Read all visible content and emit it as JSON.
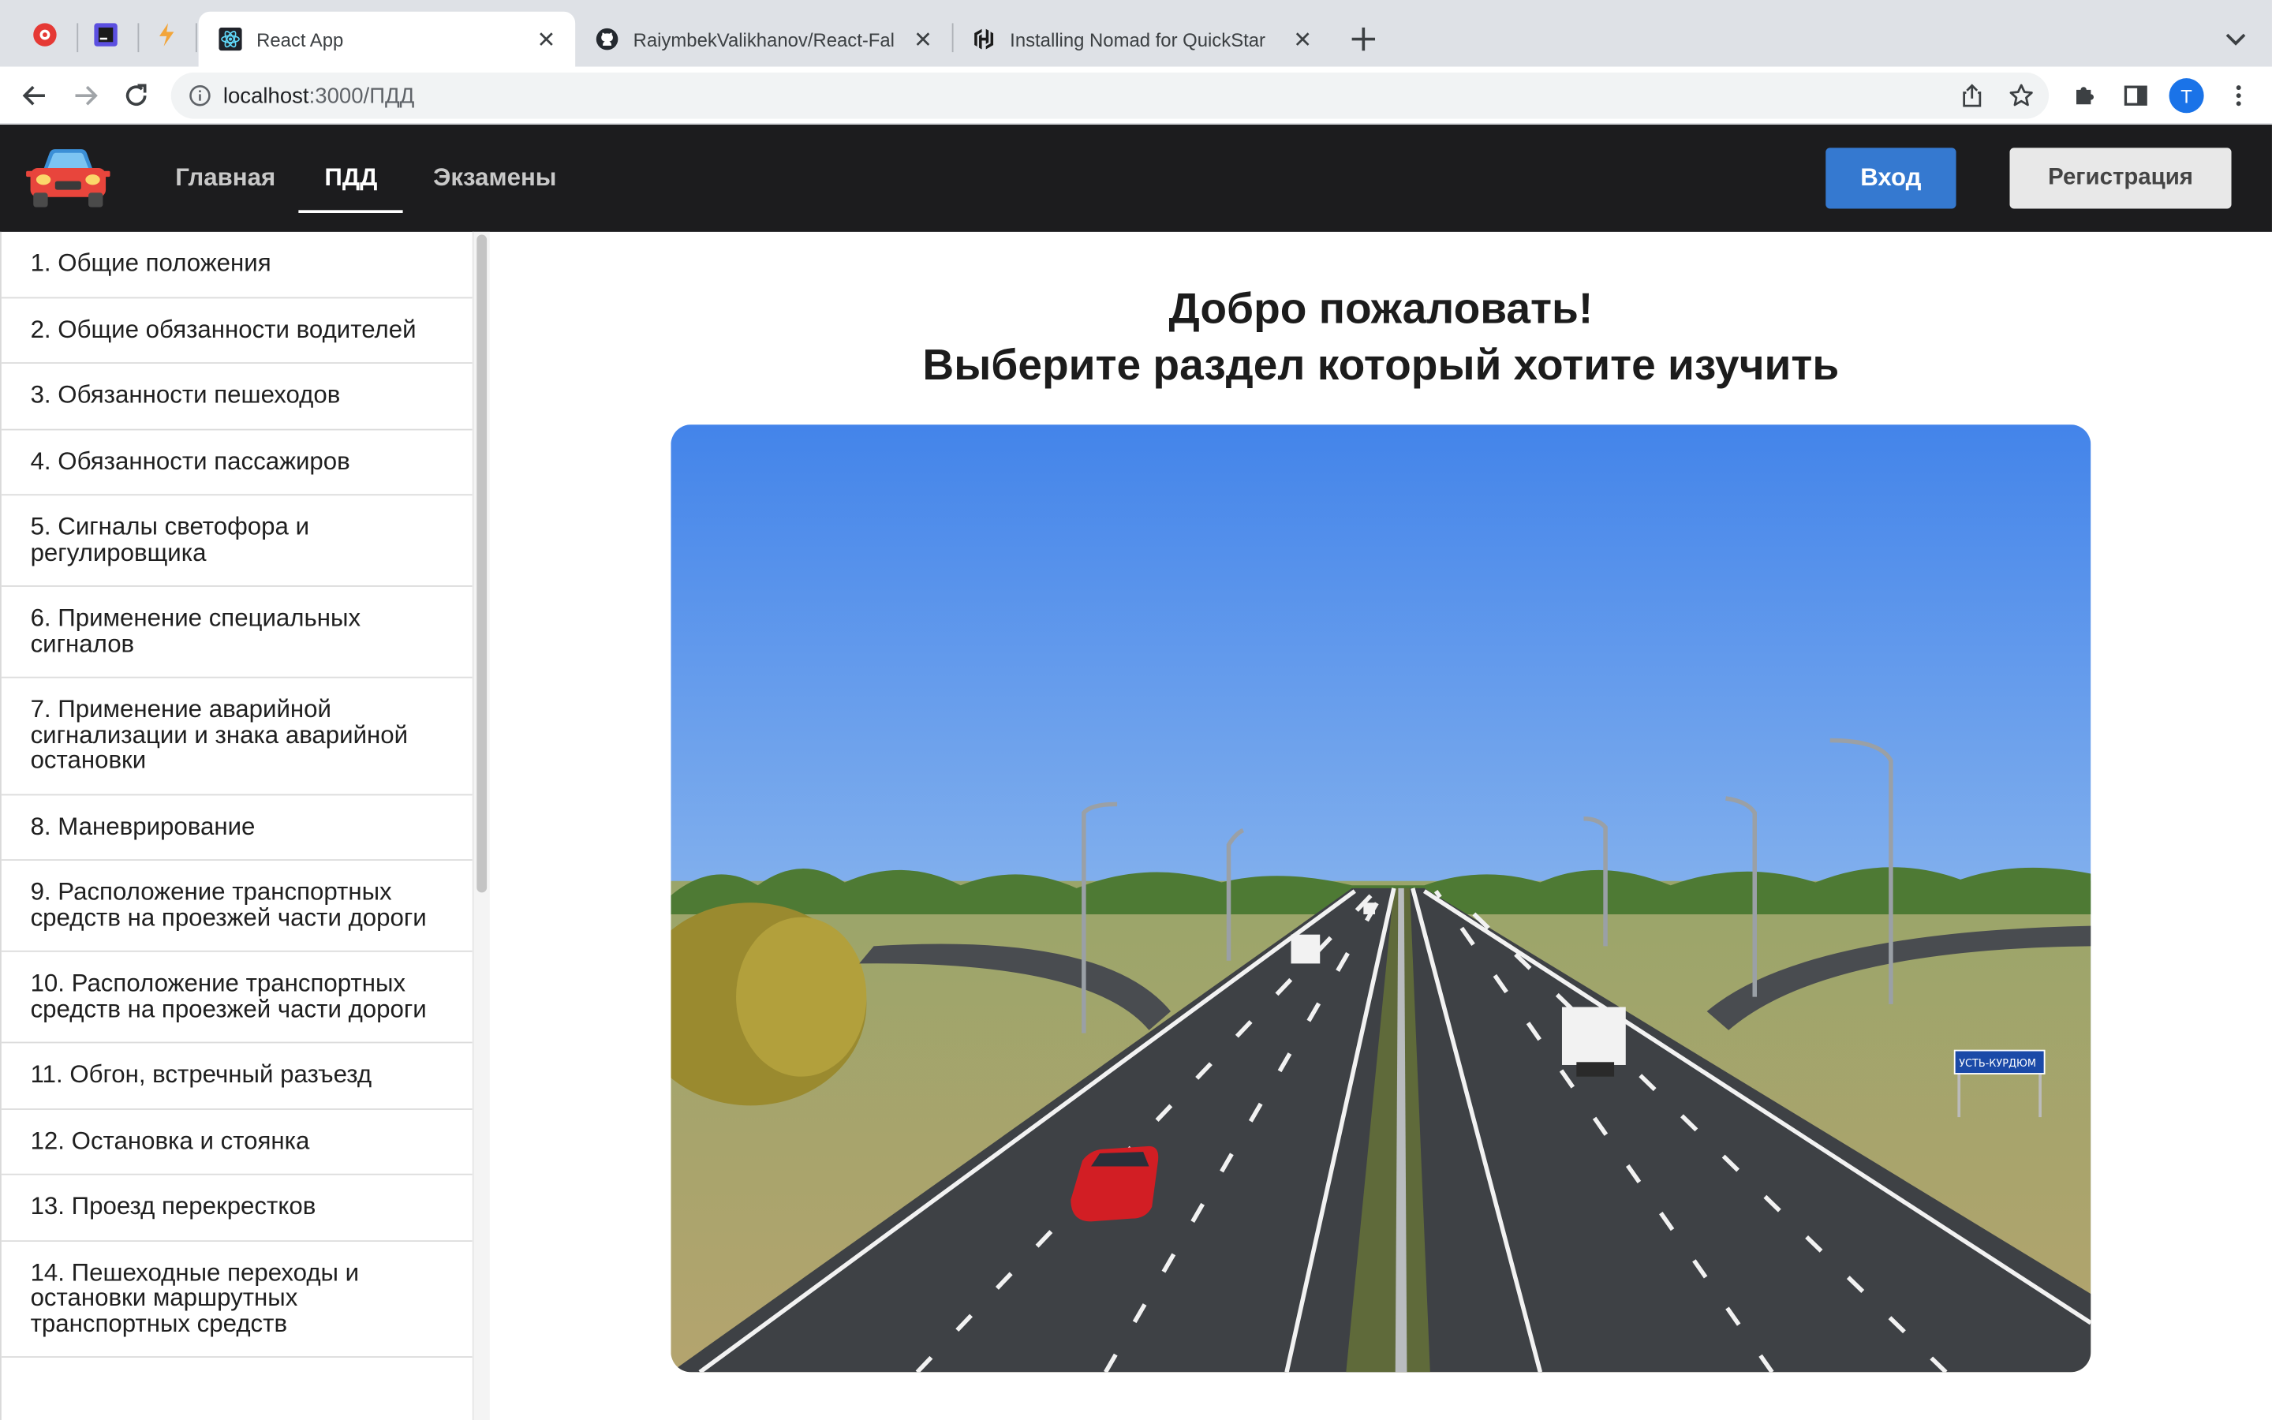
{
  "browser": {
    "pinned_tabs": [
      {
        "icon": "opera-red-icon"
      },
      {
        "icon": "intellij-icon"
      },
      {
        "icon": "chrome-labs-icon"
      }
    ],
    "tabs": [
      {
        "title": "React App",
        "icon": "react-logo-icon",
        "active": true
      },
      {
        "title": "RaiymbekValikhanov/React-Fal",
        "icon": "github-icon",
        "active": false
      },
      {
        "title": "Installing Nomad for QuickStar",
        "icon": "hashicorp-icon",
        "active": false
      }
    ],
    "url_host": "localhost",
    "url_rest": ":3000/ПДД",
    "profile_initial": "T"
  },
  "header": {
    "nav": [
      "Главная",
      "ПДД",
      "Экзамены"
    ],
    "active_nav": "ПДД",
    "login_label": "Вход",
    "register_label": "Регистрация"
  },
  "sidebar": {
    "items": [
      {
        "label": "1. Общие положения"
      },
      {
        "label": "2. Общие обязанности водителей"
      },
      {
        "label": "3. Обязанности пешеходов"
      },
      {
        "label": "4. Обязанности пассажиров"
      },
      {
        "label": "5. Сигналы светофора и регулировщика"
      },
      {
        "label": "6. Применение специальных сигналов"
      },
      {
        "label": "7. Применение аварийной сигнализации и знака аварийной остановки"
      },
      {
        "label": "8. Маневрирование"
      },
      {
        "label": "9. Расположение транспортных средств на проезжей части дороги"
      },
      {
        "label": "10. Расположение транспортных средств на проезжей части дороги"
      },
      {
        "label": "11. Обгон, встречный разъезд"
      },
      {
        "label": "12. Остановка и стоянка"
      },
      {
        "label": "13. Проезд перекрестков"
      },
      {
        "label": "14. Пешеходные переходы и остановки маршрутных транспортных средств"
      }
    ]
  },
  "main": {
    "welcome": "Добро пожаловать!",
    "subtitle": "Выберите раздел который хотите изучить",
    "road_sign_text": "УСТЬ-КУРДЮМ"
  },
  "colors": {
    "header_bg": "#1c1c1e",
    "login_bg": "#3579d0",
    "register_bg": "#e8e8e8"
  }
}
